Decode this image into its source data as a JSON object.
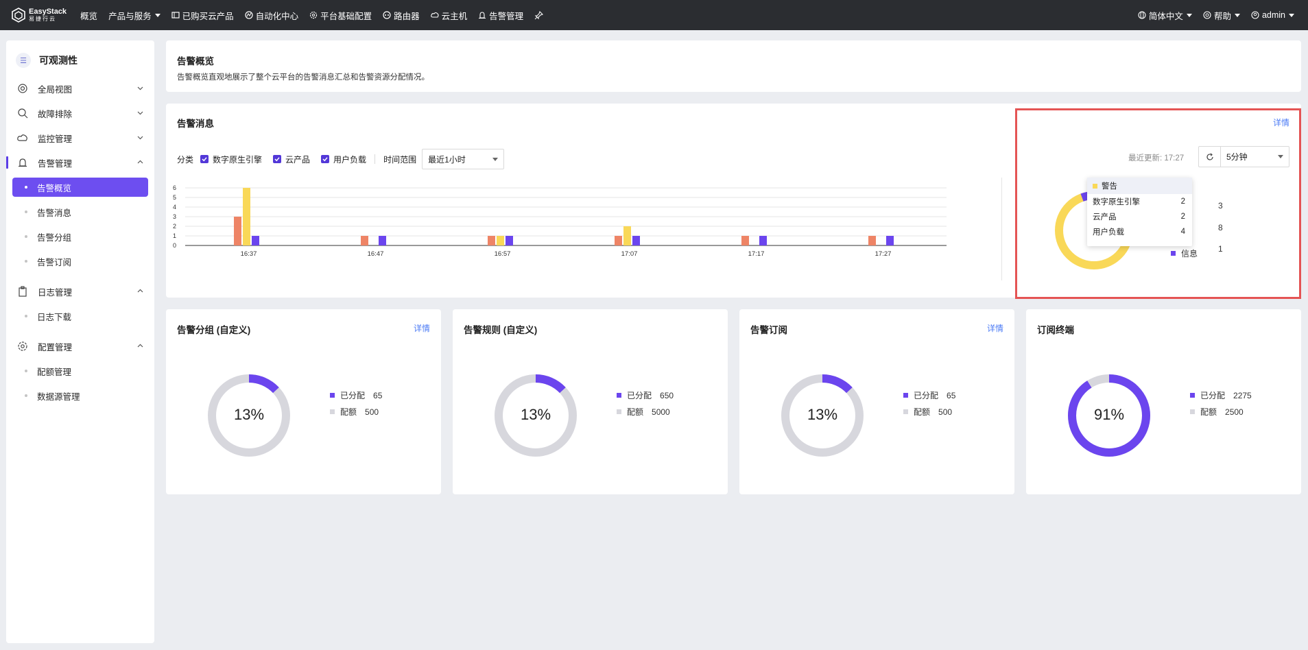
{
  "topbar": {
    "logo_name": "EasyStack",
    "logo_sub": "易捷行云",
    "nav": [
      "概览",
      "产品与服务",
      "已购买云产品",
      "自动化中心",
      "平台基础配置",
      "路由器",
      "云主机",
      "告警管理"
    ],
    "lang": "简体中文",
    "help": "帮助",
    "user": "admin"
  },
  "sidebar": {
    "title": "可观测性",
    "groups": [
      "全局视图",
      "故障排除",
      "监控管理",
      "告警管理",
      "日志管理",
      "配置管理"
    ],
    "alarm_items": [
      "告警概览",
      "告警消息",
      "告警分组",
      "告警订阅"
    ],
    "log_items": [
      "日志下载"
    ],
    "config_items": [
      "配额管理",
      "数据源管理"
    ]
  },
  "overview": {
    "title": "告警概览",
    "desc": "告警概览直观地展示了整个云平台的告警消息汇总和告警资源分配情况。"
  },
  "messages": {
    "title": "告警消息",
    "category_label": "分类",
    "categories": [
      "数字原生引擎",
      "云产品",
      "用户负载"
    ],
    "time_label": "时间范围",
    "time_value": "最近1小时",
    "detail": "详情",
    "last_update": "最近更新: 17:27",
    "interval": "5分钟",
    "legend": [
      {
        "name": "警告",
        "value": "8",
        "color": "#f9d858"
      },
      {
        "name": "信息",
        "value": "1",
        "color": "#6b45ee"
      },
      {
        "name": "",
        "value": "3",
        "color": "#ee8466"
      }
    ],
    "tooltip": {
      "title": "警告",
      "rows": [
        {
          "name": "数字原生引擎",
          "value": "2"
        },
        {
          "name": "云产品",
          "value": "2"
        },
        {
          "name": "用户负载",
          "value": "4"
        }
      ]
    }
  },
  "chart_data": {
    "type": "bar",
    "categories": [
      "16:37",
      "16:47",
      "16:57",
      "17:07",
      "17:17",
      "17:27"
    ],
    "ylim": [
      0,
      6
    ],
    "yticks": [
      "0",
      "1",
      "2",
      "3",
      "4",
      "5",
      "6"
    ],
    "series": [
      {
        "color": "#ee8466",
        "values": [
          3,
          1,
          1,
          1,
          1,
          1
        ]
      },
      {
        "color": "#f9d858",
        "values": [
          6,
          0,
          1,
          2,
          0,
          0
        ]
      },
      {
        "color": "#6b45ee",
        "values": [
          1,
          1,
          1,
          1,
          1,
          1
        ]
      }
    ]
  },
  "panels": [
    {
      "title": "告警分组 (自定义)",
      "detail": "详情",
      "pct": "13%",
      "assigned_label": "已分配",
      "assigned": "65",
      "quota_label": "配额",
      "quota": "500",
      "ratio": 0.13
    },
    {
      "title": "告警规则 (自定义)",
      "detail": "",
      "pct": "13%",
      "assigned_label": "已分配",
      "assigned": "650",
      "quota_label": "配额",
      "quota": "5000",
      "ratio": 0.13
    },
    {
      "title": "告警订阅",
      "detail": "详情",
      "pct": "13%",
      "assigned_label": "已分配",
      "assigned": "65",
      "quota_label": "配额",
      "quota": "500",
      "ratio": 0.13
    },
    {
      "title": "订阅终端",
      "detail": "",
      "pct": "91%",
      "assigned_label": "已分配",
      "assigned": "2275",
      "quota_label": "配额",
      "quota": "2500",
      "ratio": 0.91
    }
  ],
  "colors": {
    "accent": "#6b45ee",
    "warning": "#f9d858",
    "critical": "#ee8466",
    "quota": "#d7d7dd",
    "link": "#4d7cf5"
  }
}
